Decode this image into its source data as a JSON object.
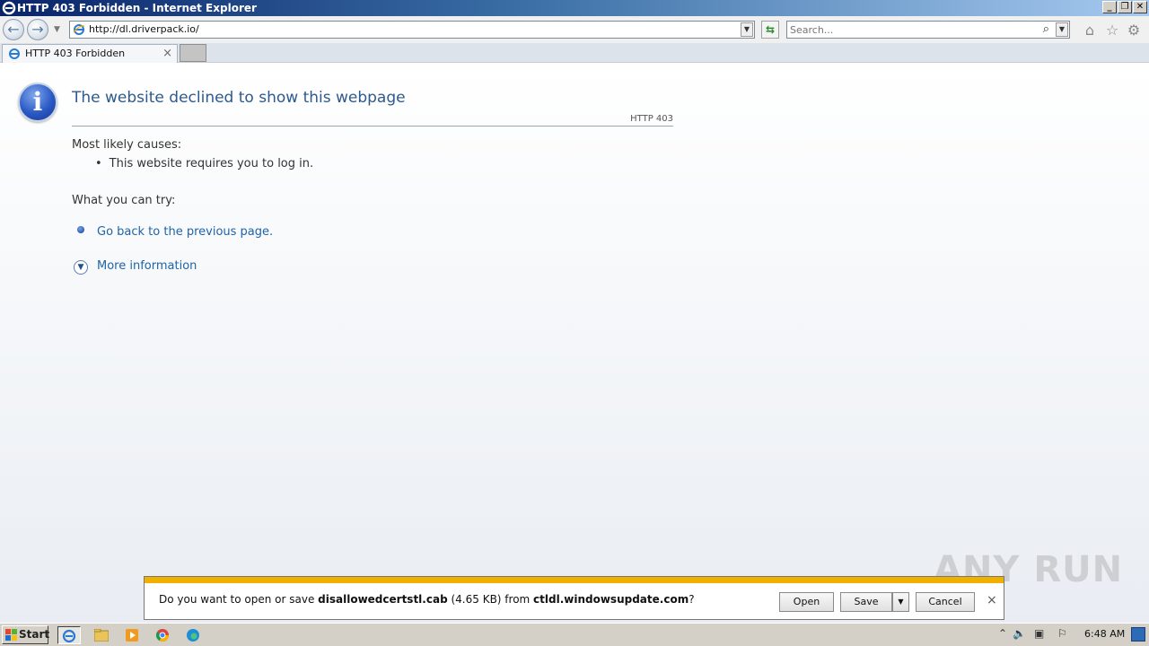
{
  "window": {
    "title": "HTTP 403 Forbidden - Internet Explorer",
    "controls": {
      "minimize": "_",
      "restore": "❐",
      "close": "✕"
    }
  },
  "toolbar": {
    "back_icon": "back-arrow-icon",
    "forward_icon": "forward-arrow-icon",
    "url": "http://dl.driverpack.io/",
    "search_placeholder": "Search..."
  },
  "tabs": [
    {
      "label": "HTTP 403 Forbidden",
      "close": "×"
    }
  ],
  "page": {
    "heading": "The website declined to show this webpage",
    "http_code": "HTTP 403",
    "causes_label": "Most likely causes:",
    "causes": [
      "This website requires you to log in."
    ],
    "try_label": "What you can try:",
    "back_link": "Go back to the previous page.",
    "more_info": "More information"
  },
  "download_bar": {
    "prefix": "Do you want to open or save ",
    "filename": "disallowedcertstl.cab",
    "size": " (4.65 KB) from ",
    "source": "ctldl.windowsupdate.com",
    "suffix": "?",
    "open_label": "Open",
    "save_label": "Save",
    "cancel_label": "Cancel",
    "close": "×"
  },
  "watermark": "ANY RUN",
  "taskbar": {
    "start_label": "Start",
    "clock": "6:48 AM"
  },
  "colors": {
    "accent_link": "#1f63a8",
    "heading": "#2d5a8c",
    "download_stripe": "#f0b000"
  }
}
